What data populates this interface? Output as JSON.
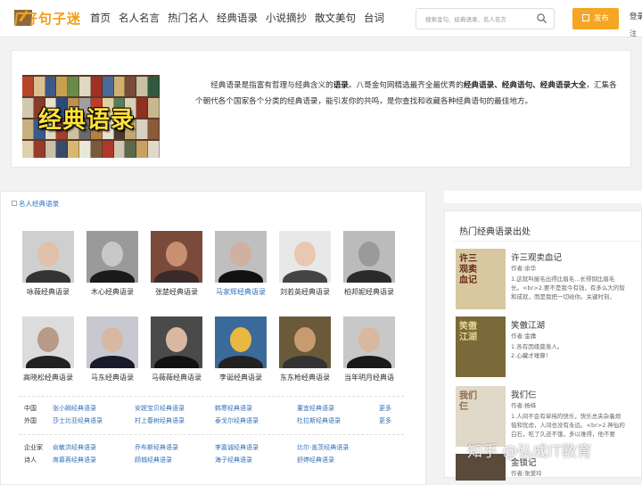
{
  "header": {
    "logo_text": "好句子迷",
    "nav": [
      "首页",
      "名人名言",
      "热门名人",
      "经典语录",
      "小说摘抄",
      "散文美句",
      "台词"
    ],
    "search_placeholder": "搜索金句、经典语录、名人名言",
    "publish_label": "发布",
    "login_label": "登录",
    "register_label": "注"
  },
  "intro": {
    "banner_text": "经典语录",
    "p1": "经典语录是指富有哲理与经典含义的",
    "b1": "语录",
    "p2": "。八哥金句网精选最齐全最优秀的",
    "b2": "经典语录、经典语句、经典语录大全",
    "p3": "，汇集各个朝代各个国家各个分类的经典语录，能引发你的共鸣，是你查找和收藏各种经典语句的最佳地方。"
  },
  "famous": {
    "title": "名人经典语录",
    "row1": [
      "咏薇经典语录",
      "木心经典语录",
      "张楚经典语录",
      "马家辉经典语录",
      "刘若英经典语录",
      "柏邦妮经典语录"
    ],
    "row2": [
      "高晓松经典语录",
      "马东经典语录",
      "马薇薇经典语录",
      "李诞经典语录",
      "东东枪经典语录",
      "当年明月经典语"
    ],
    "cat_rows": [
      {
        "label": "中国",
        "links": [
          "张小娴经典语录",
          "安妮宝贝经典语录",
          "韩寒经典语录",
          "董宜经典语录"
        ],
        "more": "更多"
      },
      {
        "label": "外国",
        "links": [
          "莎士比亚经典语录",
          "村上春树经典语录",
          "泰戈尔经典语录",
          "杜拉斯经典语录"
        ],
        "more": "更多"
      },
      {
        "label": "企业家",
        "links": [
          "俞敏洪经典语录",
          "乔布斯经典语录",
          "李嘉诚经典语录",
          "比尔·盖茨经典语录"
        ],
        "more": ""
      },
      {
        "label": "诗人",
        "links": [
          "席慕蓉经典语录",
          "顾城经典语录",
          "海子经典语录",
          "舒婷经典语录"
        ],
        "more": ""
      }
    ]
  },
  "sidebar": {
    "title": "热门经典语录出处",
    "books": [
      {
        "title": "许三观卖血记",
        "author": "作者:余华",
        "lines": [
          "1.这就叫屋毛出得比眉毛...长得倒比眉毛",
          "长。<br>2.要不是我今有钱，有多么大的智",
          "和成就，而是我把一切给你。关键时刻，"
        ]
      },
      {
        "title": "笑傲江湖",
        "author": "作者:金庸",
        "lines": [
          "1.各有因缘莫羡人。",
          "2.心藏才难算！"
        ]
      },
      {
        "title": "我们仨",
        "author": "作者:杨绛",
        "lines": [
          "1.人间不会有单纯的快乐，快乐总夹杂着烦",
          "恼和忧虑，人间也没有永远。<br>2.神仙的",
          "白石，吃了久还不饿，多以难得，他不要"
        ]
      },
      {
        "title": "金锁记",
        "author": "作者:张爱玲",
        "lines": []
      }
    ]
  },
  "watermark": "知乎 @弘成IT教育"
}
